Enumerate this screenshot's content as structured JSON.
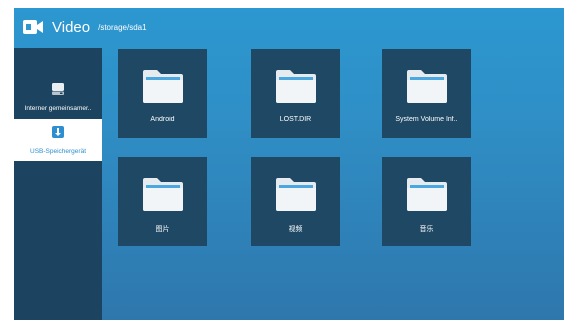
{
  "header": {
    "app_title": "Video",
    "path": "/storage/sda1",
    "app_icon": "video-camera-icon"
  },
  "sidebar": {
    "items": [
      {
        "label": "Interner gemeinsamer..",
        "icon": "hard-drive-icon",
        "selected": false
      },
      {
        "label": "USB-Speichergerät",
        "icon": "usb-drive-icon",
        "selected": true
      }
    ]
  },
  "folders": [
    {
      "name": "Android",
      "icon": "folder-icon"
    },
    {
      "name": "LOST.DIR",
      "icon": "folder-icon"
    },
    {
      "name": "System Volume Inf..",
      "icon": "folder-icon"
    },
    {
      "name": "图片",
      "icon": "folder-icon"
    },
    {
      "name": "视频",
      "icon": "folder-icon"
    },
    {
      "name": "音乐",
      "icon": "folder-icon"
    }
  ],
  "colors": {
    "background_top": "#2c97d0",
    "background_bottom": "#2e77ad",
    "tile": "#1e4864",
    "sidebar": "#1c4460",
    "accent": "#2e8fd0"
  }
}
